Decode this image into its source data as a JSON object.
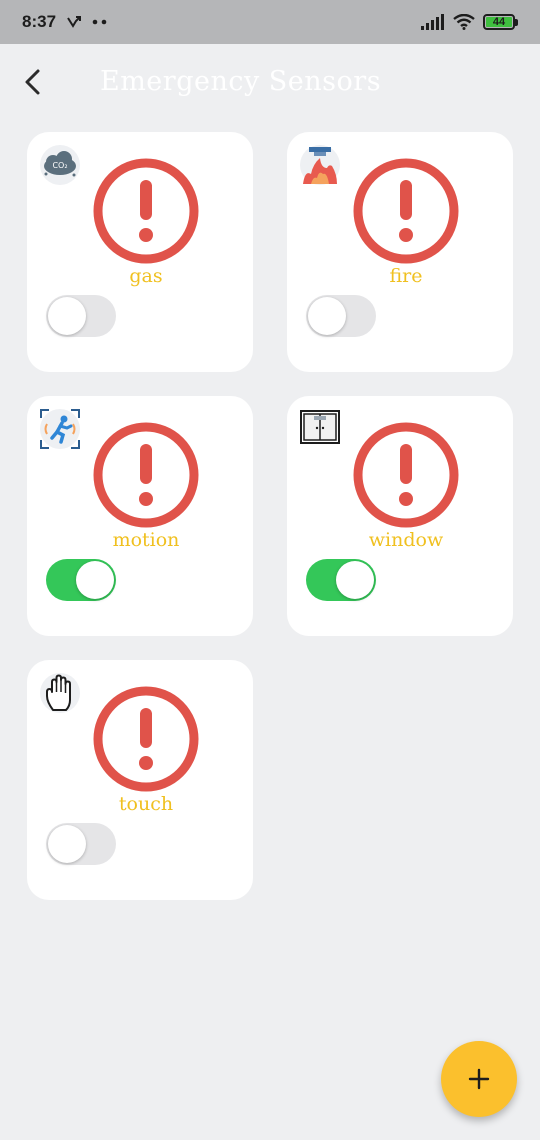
{
  "status_bar": {
    "time": "8:37",
    "battery": "44"
  },
  "app_bar": {
    "title": "Emergency Sensors"
  },
  "sensors": [
    {
      "label": "gas",
      "icon": "co2-cloud-icon",
      "enabled": false
    },
    {
      "label": "fire",
      "icon": "fire-sensor-icon",
      "enabled": false
    },
    {
      "label": "motion",
      "icon": "motion-running-icon",
      "enabled": true
    },
    {
      "label": "window",
      "icon": "window-icon",
      "enabled": true
    },
    {
      "label": "touch",
      "icon": "hand-icon",
      "enabled": false
    }
  ],
  "colors": {
    "alert": "#e0534a",
    "label": "#f0c020",
    "toggle_on": "#34c759",
    "toggle_off": "#e5e5e7",
    "fab": "#fbc02d"
  },
  "fab": {
    "icon": "plus-icon"
  }
}
